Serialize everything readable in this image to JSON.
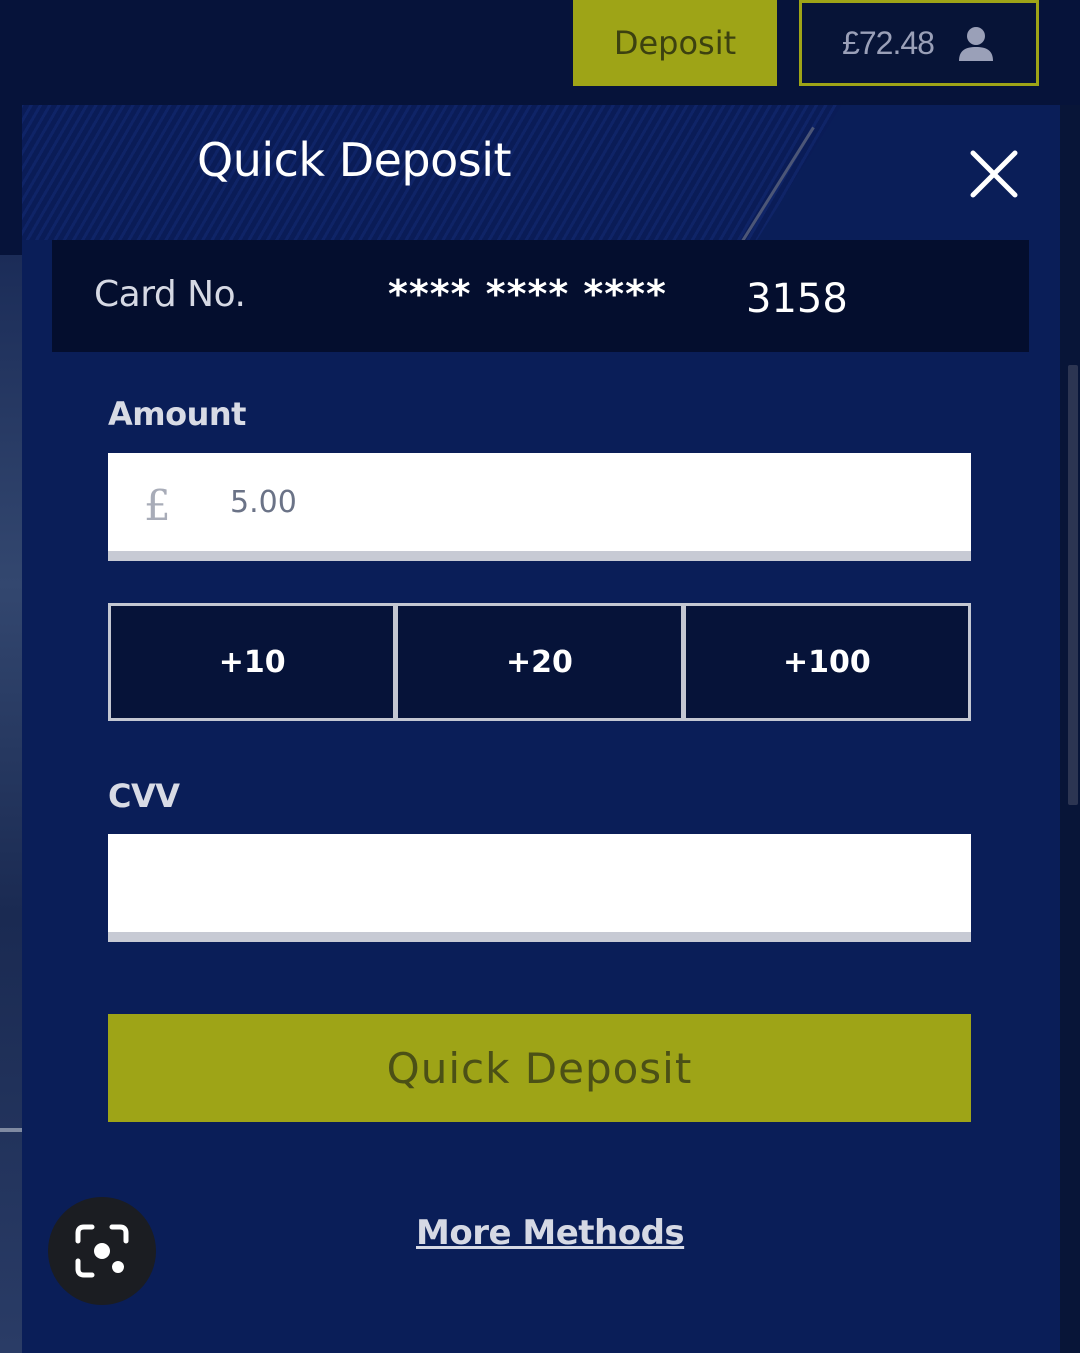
{
  "header": {
    "deposit_label": "Deposit",
    "balance": "£72.48",
    "balance_icon": "user-icon",
    "accent_color": "#9ea417"
  },
  "modal": {
    "title": "Quick Deposit",
    "close_icon": "close-icon",
    "card": {
      "label": "Card No.",
      "masked": "**** **** ****",
      "last_four": "3158"
    },
    "amount": {
      "label": "Amount",
      "currency_symbol": "£",
      "value": "5.00"
    },
    "quick_amounts": [
      "+10",
      "+20",
      "+100"
    ],
    "cvv": {
      "label": "CVV",
      "value": ""
    },
    "submit_label": "Quick Deposit",
    "more_methods_label": "More Methods",
    "background_color": "#0a1e58"
  },
  "overlay": {
    "lens_icon": "visual-search-icon"
  }
}
